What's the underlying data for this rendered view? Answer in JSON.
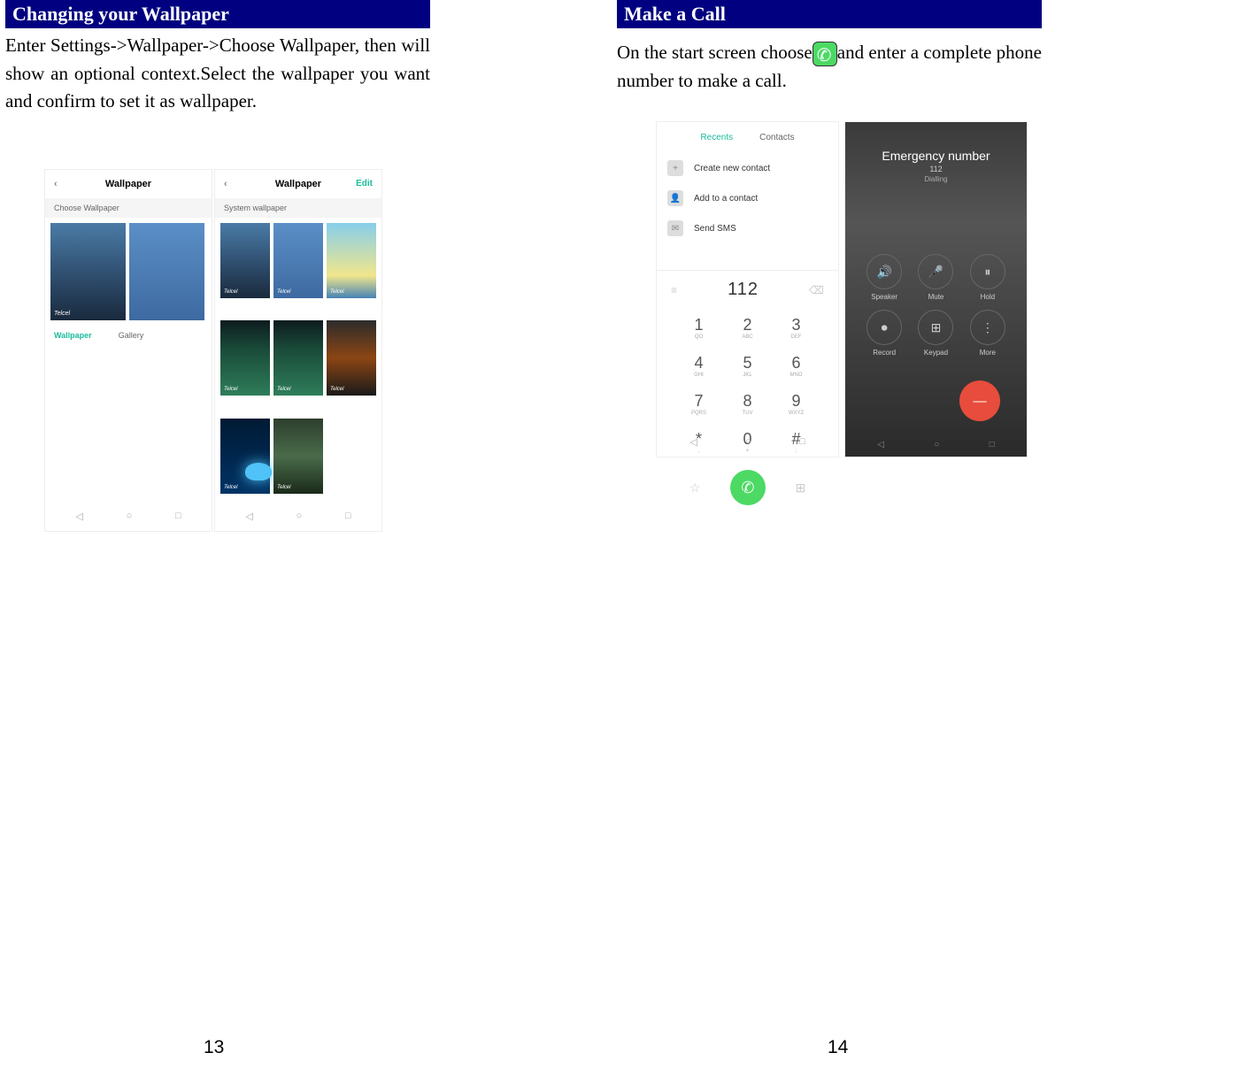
{
  "leftPage": {
    "header": "Changing your Wallpaper",
    "body": "Enter Settings->Wallpaper->Choose Wallpaper, then will show an optional context.Select the wallpaper you want and confirm to set it as wallpaper.",
    "pageNumber": "13",
    "screen1": {
      "title": "Wallpaper",
      "subheader": "Choose Wallpaper",
      "tab1": "Wallpaper",
      "tab2": "Gallery",
      "thumbLabel": "Telcel"
    },
    "screen2": {
      "title": "Wallpaper",
      "edit": "Edit",
      "subheader": "System wallpaper",
      "thumbLabel": "Telcel"
    }
  },
  "rightPage": {
    "header": "Make a Call",
    "bodyPart1": "On the start screen choose",
    "bodyPart2": "and enter a complete phone number to make a call.",
    "pageNumber": "14",
    "dialer": {
      "tab1": "Recents",
      "tab2": "Contacts",
      "action1": "Create new contact",
      "action2": "Add to a contact",
      "action3": "Send SMS",
      "number": "112",
      "keys": [
        {
          "num": "1",
          "letters": "QO"
        },
        {
          "num": "2",
          "letters": "ABC"
        },
        {
          "num": "3",
          "letters": "DEF"
        },
        {
          "num": "4",
          "letters": "GHI"
        },
        {
          "num": "5",
          "letters": "JKL"
        },
        {
          "num": "6",
          "letters": "MNO"
        },
        {
          "num": "7",
          "letters": "PQRS"
        },
        {
          "num": "8",
          "letters": "TUV"
        },
        {
          "num": "9",
          "letters": "WXYZ"
        },
        {
          "num": "*",
          "letters": "."
        },
        {
          "num": "0",
          "letters": "+"
        },
        {
          "num": "#",
          "letters": ";"
        }
      ]
    },
    "incall": {
      "title": "Emergency number",
      "number": "112",
      "status": "Dialling",
      "btn1": "Speaker",
      "btn2": "Mute",
      "btn3": "Hold",
      "btn4": "Record",
      "btn5": "Keypad",
      "btn6": "More"
    }
  }
}
